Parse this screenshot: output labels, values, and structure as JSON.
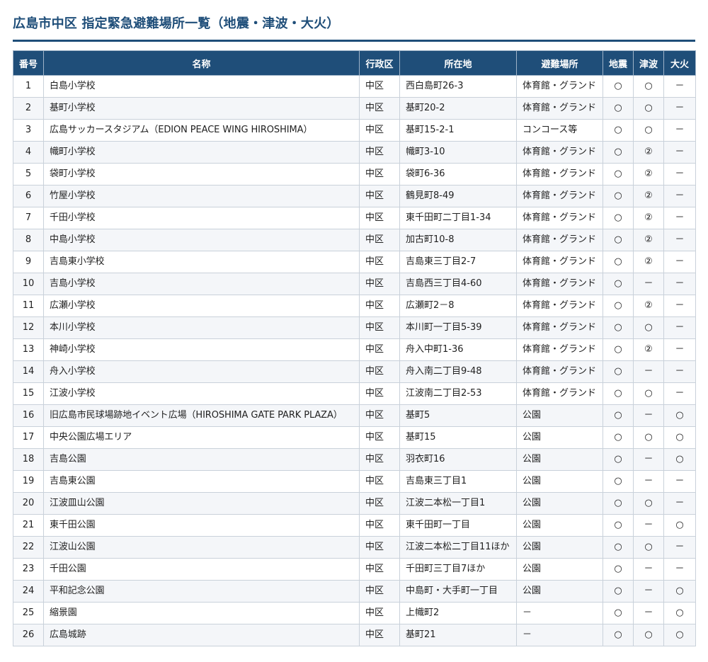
{
  "title": "広島市中区 指定緊急避難場所一覧（地震・津波・大火）",
  "table": {
    "headers": [
      "番号",
      "名称",
      "行政区",
      "所在地",
      "避難場所",
      "地震",
      "津波",
      "大火"
    ],
    "rows": [
      [
        "1",
        "白島小学校",
        "中区",
        "西白島町26-3",
        "体育館・グランド",
        "○",
        "○",
        "－"
      ],
      [
        "2",
        "基町小学校",
        "中区",
        "基町20-2",
        "体育館・グランド",
        "○",
        "○",
        "－"
      ],
      [
        "3",
        "広島サッカースタジアム（EDION PEACE WING HIROSHIMA）",
        "中区",
        "基町15-2-1",
        "コンコース等",
        "○",
        "○",
        "－"
      ],
      [
        "4",
        "幟町小学校",
        "中区",
        "幟町3-10",
        "体育館・グランド",
        "○",
        "②",
        "－"
      ],
      [
        "5",
        "袋町小学校",
        "中区",
        "袋町6-36",
        "体育館・グランド",
        "○",
        "②",
        "－"
      ],
      [
        "6",
        "竹屋小学校",
        "中区",
        "鶴見町8-49",
        "体育館・グランド",
        "○",
        "②",
        "－"
      ],
      [
        "7",
        "千田小学校",
        "中区",
        "東千田町二丁目1-34",
        "体育館・グランド",
        "○",
        "②",
        "－"
      ],
      [
        "8",
        "中島小学校",
        "中区",
        "加古町10-8",
        "体育館・グランド",
        "○",
        "②",
        "－"
      ],
      [
        "9",
        "吉島東小学校",
        "中区",
        "吉島東三丁目2-7",
        "体育館・グランド",
        "○",
        "②",
        "－"
      ],
      [
        "10",
        "吉島小学校",
        "中区",
        "吉島西三丁目4-60",
        "体育館・グランド",
        "○",
        "－",
        "－"
      ],
      [
        "11",
        "広瀬小学校",
        "中区",
        "広瀬町2－8",
        "体育館・グランド",
        "○",
        "②",
        "－"
      ],
      [
        "12",
        "本川小学校",
        "中区",
        "本川町一丁目5-39",
        "体育館・グランド",
        "○",
        "○",
        "－"
      ],
      [
        "13",
        "神崎小学校",
        "中区",
        "舟入中町1-36",
        "体育館・グランド",
        "○",
        "②",
        "－"
      ],
      [
        "14",
        "舟入小学校",
        "中区",
        "舟入南二丁目9-48",
        "体育館・グランド",
        "○",
        "－",
        "－"
      ],
      [
        "15",
        "江波小学校",
        "中区",
        "江波南二丁目2-53",
        "体育館・グランド",
        "○",
        "○",
        "－"
      ],
      [
        "16",
        "旧広島市民球場跡地イベント広場（HIROSHIMA GATE PARK PLAZA）",
        "中区",
        "基町5",
        "公園",
        "○",
        "－",
        "○"
      ],
      [
        "17",
        "中央公園広場エリア",
        "中区",
        "基町15",
        "公園",
        "○",
        "○",
        "○"
      ],
      [
        "18",
        "吉島公園",
        "中区",
        "羽衣町16",
        "公園",
        "○",
        "－",
        "○"
      ],
      [
        "19",
        "吉島東公園",
        "中区",
        "吉島東三丁目1",
        "公園",
        "○",
        "－",
        "－"
      ],
      [
        "20",
        "江波皿山公園",
        "中区",
        "江波二本松一丁目1",
        "公園",
        "○",
        "○",
        "－"
      ],
      [
        "21",
        "東千田公園",
        "中区",
        "東千田町一丁目",
        "公園",
        "○",
        "－",
        "○"
      ],
      [
        "22",
        "江波山公園",
        "中区",
        "江波二本松二丁目11ほか",
        "公園",
        "○",
        "○",
        "－"
      ],
      [
        "23",
        "千田公園",
        "中区",
        "千田町三丁目7ほか",
        "公園",
        "○",
        "－",
        "－"
      ],
      [
        "24",
        "平和記念公園",
        "中区",
        "中島町・大手町一丁目",
        "公園",
        "○",
        "－",
        "○"
      ],
      [
        "25",
        "縮景園",
        "中区",
        "上幟町2",
        "－",
        "○",
        "－",
        "○"
      ],
      [
        "26",
        "広島城跡",
        "中区",
        "基町21",
        "－",
        "○",
        "○",
        "○"
      ]
    ]
  },
  "colors": {
    "accent": "#1f4e79",
    "header_text": "#ffffff",
    "row_alt": "#f4f6f9",
    "border": "#c9d1da"
  }
}
